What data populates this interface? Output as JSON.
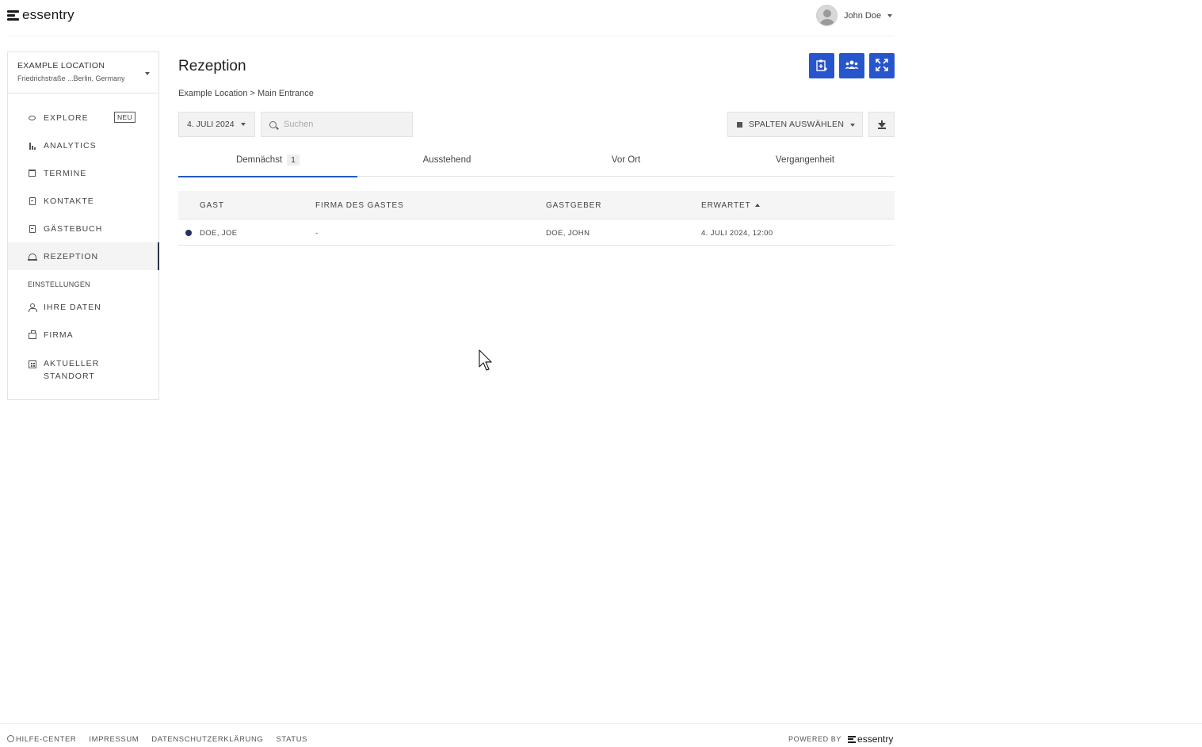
{
  "header": {
    "brand": "essentry",
    "user_name": "John Doe"
  },
  "sidebar": {
    "location": {
      "name": "EXAMPLE LOCATION",
      "address": "Friedrichstraße ...Berlin, Germany"
    },
    "items": [
      {
        "label": "EXPLORE",
        "icon": "eye-icon",
        "badge": "NEU"
      },
      {
        "label": "ANALYTICS",
        "icon": "bar-chart-icon"
      },
      {
        "label": "TERMINE",
        "icon": "calendar-icon"
      },
      {
        "label": "KONTAKTE",
        "icon": "contacts-icon"
      },
      {
        "label": "GÄSTEBUCH",
        "icon": "guestbook-icon"
      },
      {
        "label": "REZEPTION",
        "icon": "reception-bell-icon",
        "active": true
      }
    ],
    "settings_label": "EINSTELLUNGEN",
    "settings_items": [
      {
        "label": "IHRE DATEN",
        "icon": "user-icon"
      },
      {
        "label": "FIRMA",
        "icon": "briefcase-icon"
      },
      {
        "label": "AKTUELLER STANDORT",
        "line1": "AKTUELLER",
        "line2": "STANDORT",
        "icon": "building-icon"
      }
    ]
  },
  "main": {
    "title": "Rezeption",
    "breadcrumb": "Example Location > Main Entrance",
    "date_filter": "4. JULI 2024",
    "search_placeholder": "Suchen",
    "columns_button": "SPALTEN AUSWÄHLEN",
    "tabs": [
      {
        "label": "Demnächst",
        "count": "1",
        "active": true
      },
      {
        "label": "Ausstehend"
      },
      {
        "label": "Vor Ort"
      },
      {
        "label": "Vergangenheit"
      }
    ],
    "table": {
      "headers": [
        "GAST",
        "FIRMA DES GASTES",
        "GASTGEBER",
        "ERWARTET"
      ],
      "rows": [
        {
          "guest": "DOE, JOE",
          "company": "-",
          "host": "DOE, JOHN",
          "expected": "4. JULI 2024, 12:00"
        }
      ]
    }
  },
  "footer": {
    "links": [
      "HILFE-CENTER",
      "IMPRESSUM",
      "DATENSCHUTZERKLÄRUNG",
      "STATUS"
    ],
    "powered_by": "POWERED BY",
    "brand": "essentry"
  },
  "colors": {
    "accent": "#2756cc",
    "active_indicator": "#2b3548",
    "status_dot": "#24305e"
  }
}
